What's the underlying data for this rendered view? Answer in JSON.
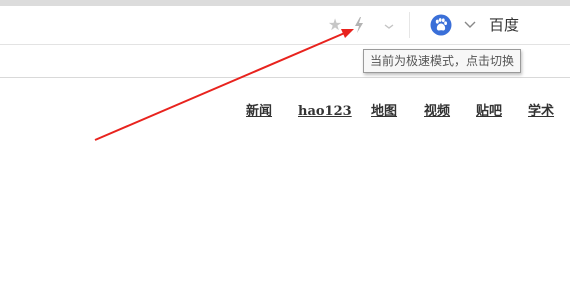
{
  "toolbar": {
    "star_icon": "star-icon",
    "bolt_icon": "bolt-icon",
    "mode_dropdown_icon": "chevron-down-icon",
    "engine_logo_icon": "baidu-paw-icon",
    "engine_chevron_icon": "chevron-down-icon",
    "engine_name": "百度"
  },
  "tooltip": {
    "text": "当前为极速模式，点击切换"
  },
  "nav": {
    "links": [
      "新闻",
      "hao123",
      "地图",
      "视频",
      "贴吧",
      "学术"
    ]
  },
  "colors": {
    "arrow": "#e8231e",
    "engine_logo_bg": "#3a6fd8",
    "link_text": "#333333"
  }
}
